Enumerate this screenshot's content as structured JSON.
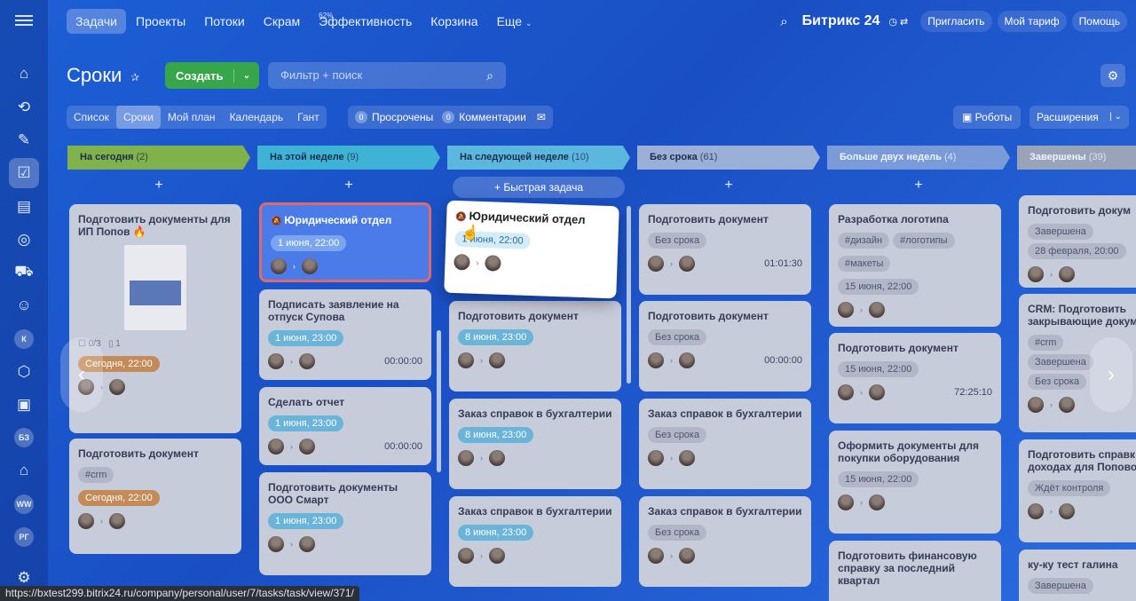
{
  "topnav": {
    "tabs": [
      "Задачи",
      "Проекты",
      "Потоки",
      "Скрам",
      "Эффективность",
      "Корзина",
      "Еще"
    ],
    "efficiency_pct": "62%",
    "brand": "Битрикс 24",
    "invite": "Пригласить",
    "tariff": "Мой тариф",
    "help": "Помощь"
  },
  "sidebar": {
    "badges": [
      "К",
      "БЗ",
      "WW",
      "РГ"
    ]
  },
  "page": {
    "title": "Сроки",
    "create": "Создать",
    "search_placeholder": "Фильтр + поиск"
  },
  "views": {
    "tabs": [
      "Список",
      "Сроки",
      "Мой план",
      "Календарь",
      "Гант"
    ],
    "overdue_count": "0",
    "overdue_label": "Просрочены",
    "comments_count": "0",
    "comments_label": "Комментарии",
    "robots": "Роботы",
    "extensions": "Расширения"
  },
  "columns": [
    {
      "title": "На сегодня",
      "count": "(2)",
      "color": "#7fb24a"
    },
    {
      "title": "На этой неделе",
      "count": "(9)",
      "color": "#3fb3d6"
    },
    {
      "title": "На следующей неделе",
      "count": "(10)",
      "color": "#5cb7de"
    },
    {
      "title": "Без срока",
      "count": "(61)",
      "color": "#9ab0d6"
    },
    {
      "title": "Больше двух недель",
      "count": "(4)",
      "color": "#7a9bd8"
    },
    {
      "title": "Завершены",
      "count": "(39)",
      "color": "#9aa4b8"
    }
  ],
  "quick_task": "+ Быстрая задача",
  "cards": {
    "c0_0": {
      "title": "Подготовить документы для ИП Попов 🔥",
      "meta": "0/3",
      "files": "1",
      "date": "Сегодня, 22:00"
    },
    "c0_1": {
      "title": "Подготовить документ",
      "tag": "#crm",
      "date": "Сегодня, 22:00"
    },
    "c1_0": {
      "title": "Юридический отдел",
      "date": "1 июня, 22:00"
    },
    "c1_1": {
      "title": "Подписать заявление на отпуск Супова",
      "date": "1 июня, 23:00",
      "timer": "00:00:00"
    },
    "c1_2": {
      "title": "Сделать отчет",
      "date": "1 июня, 23:00",
      "timer": "00:00:00"
    },
    "c1_3": {
      "title": "Подготовить документы ООО Смарт",
      "date": "1 июня, 23:00"
    },
    "c2_drag": {
      "title": "Юридический отдел",
      "date": "1 июня, 22:00"
    },
    "c2_1": {
      "title": "Подготовить документ",
      "date": "8 июня, 23:00"
    },
    "c2_2": {
      "title": "Заказ справок в бухгалтерии",
      "date": "8 июня, 23:00"
    },
    "c2_3": {
      "title": "Заказ справок в бухгалтерии",
      "date": "8 июня, 23:00"
    },
    "c3_0": {
      "title": "Подготовить документ",
      "tag": "Без срока",
      "timer": "01:01:30"
    },
    "c3_1": {
      "title": "Подготовить документ",
      "tag": "Без срока",
      "timer": "00:00:00"
    },
    "c3_2": {
      "title": "Заказ справок в бухгалтерии",
      "tag": "Без срока"
    },
    "c3_3": {
      "title": "Заказ справок в бухгалтерии",
      "tag": "Без срока"
    },
    "c4_0": {
      "title": "Разработка логотипа",
      "tags": [
        "#дизайн",
        "#логотипы",
        "#макеты"
      ],
      "date": "15 июня, 22:00"
    },
    "c4_1": {
      "title": "Подготовить документ",
      "date": "15 июня, 22:00",
      "timer": "72:25:10"
    },
    "c4_2": {
      "title": "Оформить документы для покупки оборудования",
      "date": "15 июня, 22:00"
    },
    "c4_3": {
      "title": "Подготовить финансовую справку за последний квартал"
    },
    "c5_0": {
      "title": "Подготовить докум",
      "tag": "Завершена",
      "date": "28 февраля, 20:00"
    },
    "c5_1": {
      "title": "CRM: Подготовить закрывающие документы",
      "tags": [
        "#crm",
        "Завершена",
        "Без срока"
      ]
    },
    "c5_2": {
      "title": "Подготовить справк о доходах для Поповой",
      "tag": "Ждёт контроля"
    },
    "c5_3": {
      "title": "ку-ку тест галина",
      "tag": "Завершена"
    }
  },
  "status_url": "https://bxtest299.bitrix24.ru/company/personal/user/7/tasks/task/view/371/"
}
